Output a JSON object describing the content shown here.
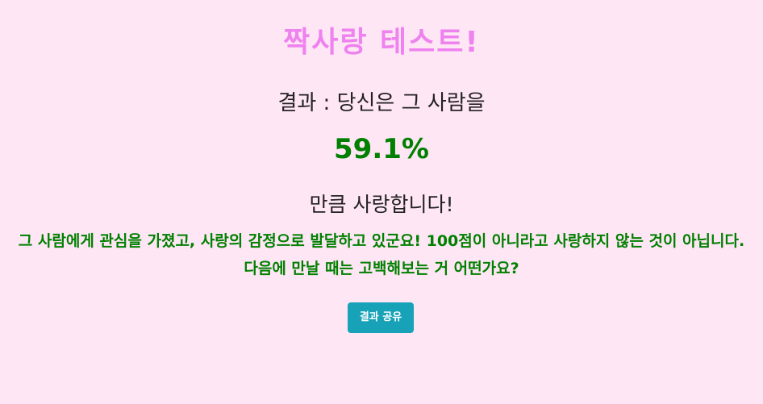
{
  "header": {
    "title": "짝사랑 테스트!"
  },
  "result": {
    "label": "결과 : 당신은 그 사람을",
    "percent": "59.1%",
    "love_text": "만큼 사랑합니다!",
    "message": "그 사람에게 관심을 가졌고, 사랑의 감정으로 발달하고 있군요! 100점이 아니라고 사랑하지 않는 것이 아닙니다. 다음에 만날 때는 고백해보는 거 어떤가요?"
  },
  "actions": {
    "share_label": "결과 공유"
  },
  "colors": {
    "background": "#ffe6f5",
    "title": "#ee82ee",
    "accent_green": "#008000",
    "button": "#17a2b8"
  }
}
